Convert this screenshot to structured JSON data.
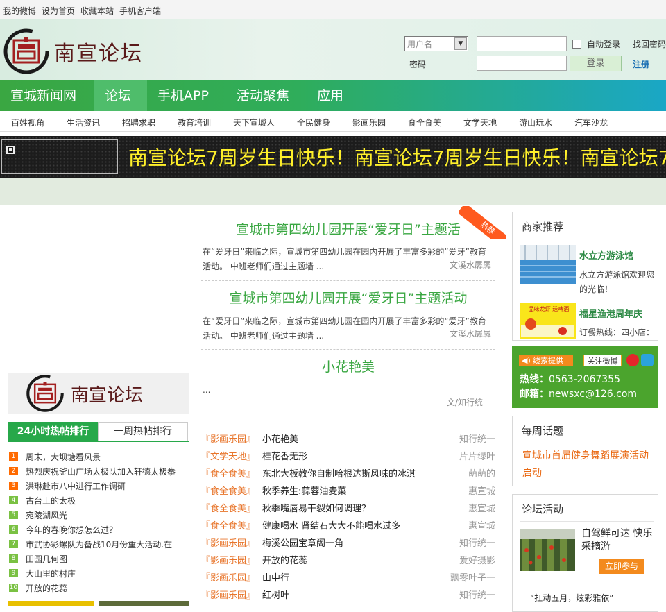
{
  "topbar": {
    "links": [
      "我的微博",
      "设为首页",
      "收藏本站",
      "手机客户端"
    ]
  },
  "logo": {
    "text": "南宣论坛"
  },
  "login": {
    "username_placeholder": "用户名",
    "password_label": "密码",
    "auto_login": "自动登录",
    "forgot": "找回密码",
    "login_button": "登录",
    "register": "注册"
  },
  "nav": {
    "items": [
      "宣城新闻网",
      "论坛",
      "手机APP",
      "活动聚焦",
      "应用"
    ],
    "active": "论坛"
  },
  "subnav": {
    "items": [
      "百姓视角",
      "生活资讯",
      "招聘求职",
      "教育培训",
      "天下宣城人",
      "全民健身",
      "影画乐园",
      "食全食美",
      "文学天地",
      "游山玩水",
      "汽车沙龙"
    ]
  },
  "banner": {
    "text": "南宣论坛7周岁生日快乐！南宣论坛7周岁生日快乐！南宣论坛7"
  },
  "featured": {
    "ribbon": "热荐",
    "items": [
      {
        "title": "宣城市第四幼儿园开展“爱牙日”主题活",
        "desc": "在“爱牙日”来临之际，宣城市第四幼儿园在园内开展了丰富多彩的“爱牙”教育活动。 中班老师们通过主题墙 ...",
        "source": "文溪水孱孱"
      },
      {
        "title": "宣城市第四幼儿园开展“爱牙日”主题活动",
        "desc": "在“爱牙日”来临之际，宣城市第四幼儿园在园内开展了丰富多彩的“爱牙”教育活动。 中班老师们通过主题墙 ...",
        "source": "文溪水孱孱"
      },
      {
        "title": "小花艳美",
        "desc": "...",
        "source": "文/知行统一"
      }
    ]
  },
  "thread_list": [
    {
      "cat": "『影画乐园』",
      "title": "小花艳美",
      "author": "知行统一"
    },
    {
      "cat": "『文学天地』",
      "title": "桂花香无形",
      "author": "片片绿叶"
    },
    {
      "cat": "『食全食美』",
      "title": "东北大板教你自制哈根达斯风味的冰淇",
      "author": "萌萌的"
    },
    {
      "cat": "『食全食美』",
      "title": "秋季养生:蒜蓉油麦菜",
      "author": "惠宣城"
    },
    {
      "cat": "『食全食美』",
      "title": "秋季嘴唇易干裂如何调理？",
      "author": "惠宣城"
    },
    {
      "cat": "『食全食美』",
      "title": "健康喝水 肾结石大大不能喝水过多",
      "author": "惠宣城"
    },
    {
      "cat": "『影画乐园』",
      "title": "梅溪公园宝章阁一角",
      "author": "知行统一"
    },
    {
      "cat": "『影画乐园』",
      "title": "开放的花蕊",
      "author": "爱好摄影"
    },
    {
      "cat": "『影画乐园』",
      "title": "山中行",
      "author": "飘零叶子一"
    },
    {
      "cat": "『影画乐园』",
      "title": "红树叶",
      "author": "知行统一"
    }
  ],
  "hot_tabs": {
    "tab1": "24小时热帖排行",
    "tab2": "一周热帖排行"
  },
  "hot_posts": [
    {
      "n": "1",
      "title": "周末，大坝塘看风景",
      "color": "#ff6a00"
    },
    {
      "n": "2",
      "title": "热烈庆祝釜山广场太极队加入轩德太极拳",
      "color": "#ff6a00"
    },
    {
      "n": "3",
      "title": "洪琳赴市八中进行工作调研",
      "color": "#ff6a00"
    },
    {
      "n": "4",
      "title": "古台上的太极",
      "color": "#7ac143"
    },
    {
      "n": "5",
      "title": "宛陵湖风光",
      "color": "#7ac143"
    },
    {
      "n": "6",
      "title": "今年的春晚你想怎么过？",
      "color": "#7ac143"
    },
    {
      "n": "7",
      "title": "市武协彩螺队为备战10月份重大活动.在",
      "color": "#7ac143"
    },
    {
      "n": "8",
      "title": "田园几何图",
      "color": "#7ac143"
    },
    {
      "n": "9",
      "title": "大山里的村庄",
      "color": "#7ac143"
    },
    {
      "n": "10",
      "title": "开放的花蕊",
      "color": "#7ac143"
    }
  ],
  "merchants": {
    "heading": "商家推荐",
    "items": [
      {
        "name": "水立方游泳馆",
        "desc": "水立方游泳馆欢迎您的光临！",
        "img_text": ""
      },
      {
        "name": "福星渔港周年庆",
        "desc": "订餐热线：四小店：",
        "img_text": "品味龙虾 送啤酒"
      }
    ]
  },
  "clue": {
    "tip": "线索提供",
    "follow": "关注微博",
    "hotline_label": "热线：",
    "hotline": "0563-2067355",
    "email_label": "邮箱：",
    "email": "newsxc@126.com"
  },
  "weekly": {
    "heading": "每周话题",
    "topic": "宣城市首届健身舞蹈展演活动启动"
  },
  "forum_activity": {
    "heading": "论坛活动",
    "title": "自驾鲜可达 快乐采摘游",
    "button": "立即参与",
    "next": "“扛动五月，炫彩雅依”"
  }
}
